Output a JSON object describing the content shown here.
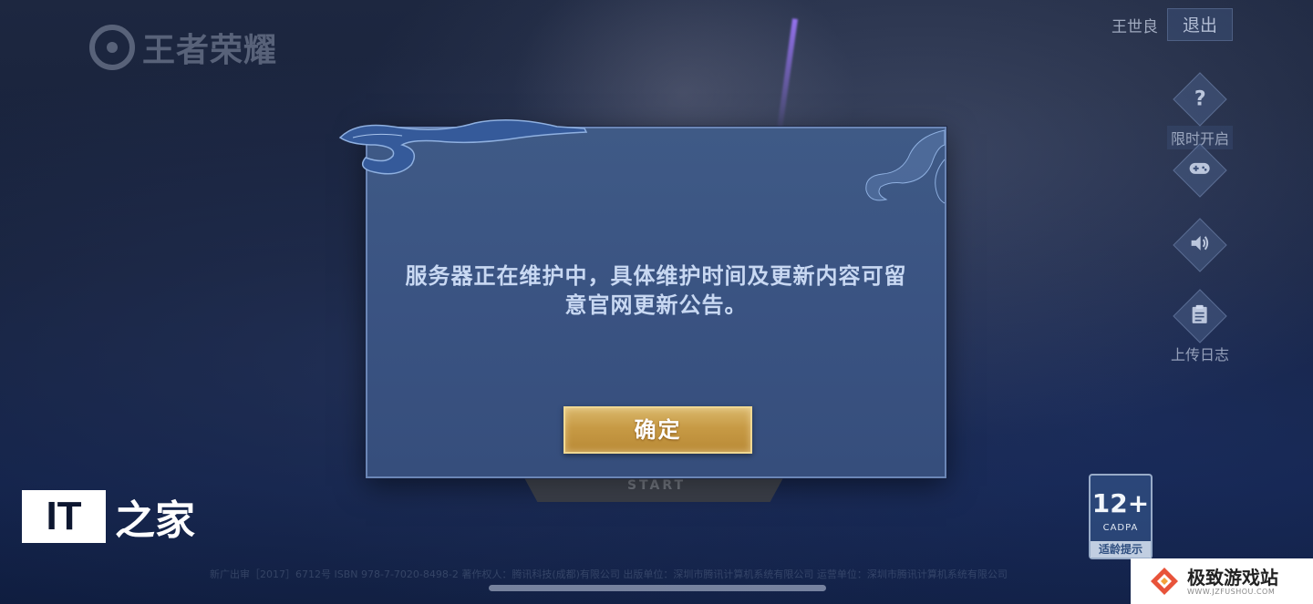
{
  "game": {
    "logo_text": "王者荣耀"
  },
  "account": {
    "username": "王世良",
    "logout_label": "退出"
  },
  "side_buttons": [
    {
      "icon": "question-icon",
      "glyph": "?",
      "label": "限时开启"
    },
    {
      "icon": "gamepad-icon",
      "glyph": "🎮",
      "label": ""
    },
    {
      "icon": "speaker-icon",
      "glyph": "🔊",
      "label": ""
    },
    {
      "icon": "clipboard-icon",
      "glyph": "📋",
      "label": "上传日志"
    }
  ],
  "dialog": {
    "message": "服务器正在维护中，具体维护时间及更新内容可留意官网更新公告。",
    "confirm_label": "确定"
  },
  "start_button": {
    "label": "START"
  },
  "age_rating": {
    "age": "12+",
    "org": "CADPA",
    "tip": "适龄提示"
  },
  "watermark": {
    "it_box": "IT",
    "it_text": "之家"
  },
  "site_watermark": {
    "title": "极致游戏站",
    "url": "WWW.JZFUSHOU.COM"
  },
  "footer": {
    "legal_text": "新广出审［2017］6712号  ISBN 978-7-7020-8498-2  著作权人：腾讯科技(成都)有限公司  出版单位：深圳市腾讯计算机系统有限公司  运营单位：深圳市腾讯计算机系统有限公司"
  },
  "colors": {
    "dialog_bg": "#3a5382",
    "dialog_border": "#6b86b6",
    "button_gold": "#c79a45",
    "message_text": "#c8d8f2"
  }
}
